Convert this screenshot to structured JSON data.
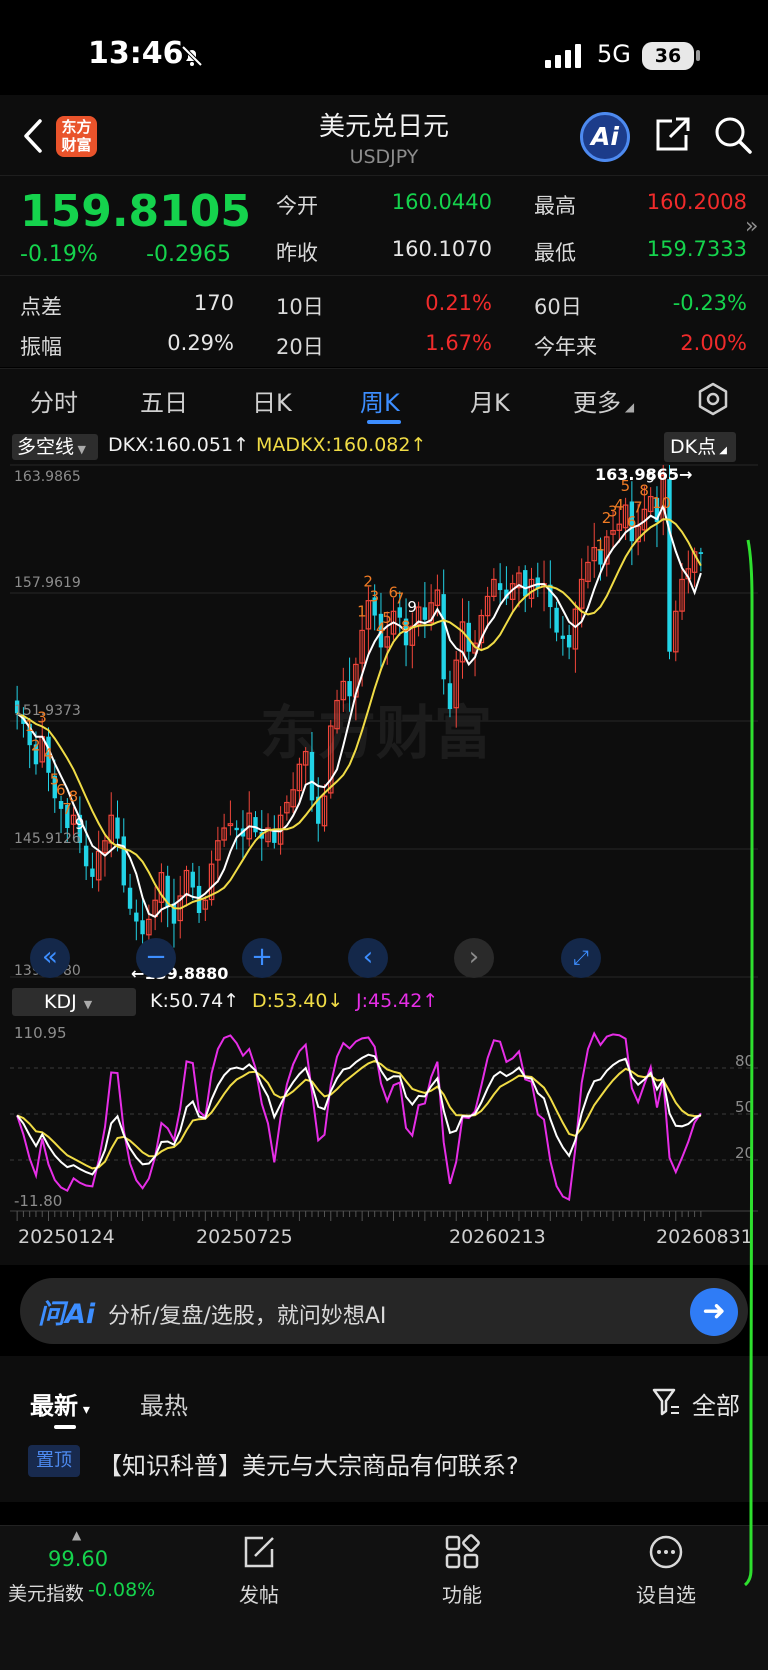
{
  "status_bar": {
    "time": "13:46",
    "network": "5G",
    "battery": "36"
  },
  "header": {
    "title": "美元兑日元",
    "code": "USDJPY",
    "logo_text": "东方财富",
    "ai_label": "Ai"
  },
  "quote": {
    "price": "159.8105",
    "change_pct": "-0.19%",
    "change_abs": "-0.2965",
    "rows": [
      {
        "label1": "今开",
        "val1": "160.0440",
        "label2": "最高",
        "val2": "160.2008"
      },
      {
        "label1": "昨收",
        "val1": "160.1070",
        "label2": "最低",
        "val2": "159.7333"
      }
    ],
    "stats": [
      {
        "label1": "点差",
        "val1": "170",
        "label2": "10日",
        "val2": "0.21%",
        "label3": "60日",
        "val3": "-0.23%"
      },
      {
        "label1": "振幅",
        "val1": "0.29%",
        "label2": "20日",
        "val2": "1.67%",
        "label3": "今年来",
        "val3": "2.00%"
      }
    ]
  },
  "tabs": [
    "分时",
    "五日",
    "日K",
    "周K",
    "月K",
    "更多"
  ],
  "active_tab": "周K",
  "price_chart": {
    "indicator": "多空线",
    "dkx": "DKX:160.051↑",
    "madkx": "MADKX:160.082↑",
    "dk_button": "DK点",
    "y_labels": [
      "163.9865",
      "157.9619",
      "151.9373",
      "145.9126",
      "139.8880"
    ],
    "high_marker": "163.9865→",
    "low_marker": "←139.8880",
    "watermark": "东方财富"
  },
  "kdj": {
    "indicator": "KDJ",
    "k": "K:50.74↑",
    "d": "D:53.40↓",
    "j": "J:45.42↑",
    "y_labels": [
      "110.95",
      "-11.80"
    ],
    "right_labels": [
      "80",
      "50",
      "20"
    ]
  },
  "dates": [
    "20250124",
    "20250725",
    "20260213",
    "20260831"
  ],
  "ai_bar": {
    "brand": "问Ai",
    "prompt": "分析/复盘/选股，就问妙想AI"
  },
  "news": {
    "tab_latest": "最新",
    "tab_hot": "最热",
    "filter": "全部",
    "pin_badge": "置顶",
    "pinned_headline": "【知识科普】美元与大宗商品有何联系?"
  },
  "bottom_nav": {
    "index_value": "99.60",
    "index_name": "美元指数",
    "index_change": "-0.08%",
    "items": [
      "发帖",
      "功能",
      "设自选"
    ]
  },
  "chart_data": {
    "type": "candlestick",
    "title": "",
    "ylim": [
      139.888,
      163.9865
    ],
    "x_range": [
      "20250124",
      "20260831"
    ],
    "highest": 163.9865,
    "lowest": 139.888,
    "last": {
      "DKX": 160.051,
      "MADKX": 160.082,
      "K": 50.74,
      "D": 53.4,
      "J": 45.42
    },
    "close": [
      152.3,
      151.8,
      150.8,
      149.9,
      151.2,
      149.5,
      148.3,
      147.8,
      146.9,
      147.5,
      146.2,
      145.1,
      144.6,
      145.8,
      146.3,
      147.5,
      146.4,
      144.2,
      143.1,
      142.5,
      141.9,
      142.6,
      143.5,
      144.8,
      143.2,
      142.4,
      143.7,
      144.9,
      144.1,
      142.9,
      143.5,
      145.2,
      146.3,
      146.9,
      147.1,
      146.8,
      146.5,
      147.6,
      146.7,
      146.4,
      146.9,
      146.2,
      147.5,
      148.1,
      148.7,
      149.9,
      150.5,
      148.2,
      147.1,
      148.4,
      151.7,
      152.9,
      153.8,
      153.1,
      154.6,
      156.2,
      157.6,
      156.9,
      155.4,
      155.9,
      157.1,
      156.8,
      155.5,
      156.4,
      157.3,
      156.7,
      157.5,
      158.1,
      153.9,
      152.5,
      154.8,
      156.6,
      155.2,
      155.6,
      156.9,
      157.8,
      158.6,
      158.1,
      157.7,
      158.4,
      158.9,
      157.8,
      158.6,
      158.2,
      158.4,
      157.3,
      156.1,
      155.8,
      155.4,
      157.2,
      158.6,
      159.4,
      160.1,
      159.3,
      160.6,
      160.9,
      161.2,
      162.1,
      160.4,
      161.1,
      161.9,
      162.5,
      161.3,
      163.5,
      155.2,
      157.1,
      158.6,
      159.1,
      159.9,
      159.8
    ]
  }
}
